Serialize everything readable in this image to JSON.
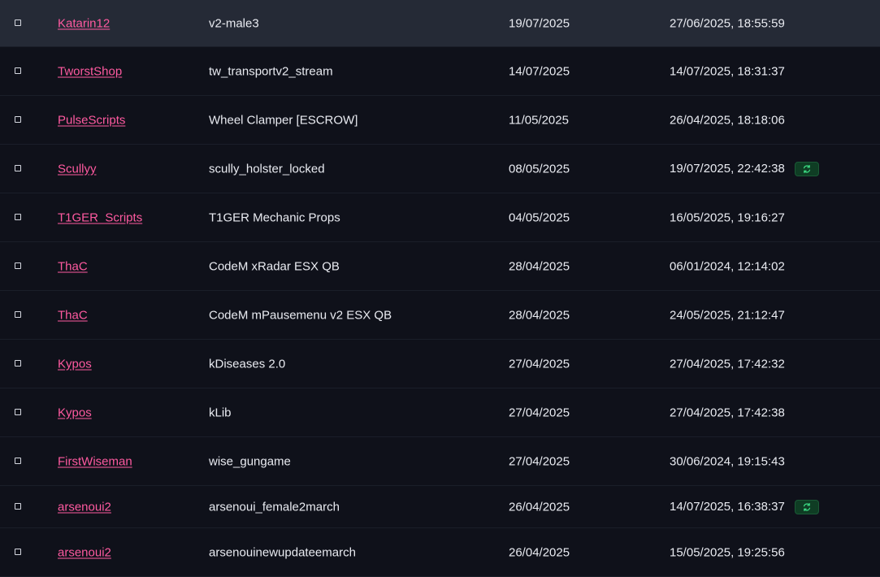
{
  "colors": {
    "background": "#0f111a",
    "row_highlight": "#252a36",
    "link": "#ff5aa0",
    "badge_bg": "#0f3d24",
    "badge_icon": "#3ddc84"
  },
  "rows": [
    {
      "seller": "Katarin12",
      "product": "v2-male3",
      "date": "19/07/2025",
      "updated": "27/06/2025, 18:55:59",
      "badge": false,
      "highlight": true
    },
    {
      "seller": "TworstShop",
      "product": "tw_transportv2_stream",
      "date": "14/07/2025",
      "updated": "14/07/2025, 18:31:37",
      "badge": false
    },
    {
      "seller": "PulseScripts",
      "product": "Wheel Clamper [ESCROW]",
      "date": "11/05/2025",
      "updated": "26/04/2025, 18:18:06",
      "badge": false
    },
    {
      "seller": "Scullyy",
      "product": "scully_holster_locked",
      "date": "08/05/2025",
      "updated": "19/07/2025, 22:42:38",
      "badge": true,
      "badge_icon": "refresh-icon"
    },
    {
      "seller": "T1GER_Scripts",
      "product": "T1GER Mechanic Props",
      "date": "04/05/2025",
      "updated": "16/05/2025, 19:16:27",
      "badge": false
    },
    {
      "seller": "ThaC",
      "product": "CodeM xRadar ESX QB",
      "date": "28/04/2025",
      "updated": "06/01/2024, 12:14:02",
      "badge": false
    },
    {
      "seller": "ThaC",
      "product": "CodeM mPausemenu v2 ESX QB",
      "date": "28/04/2025",
      "updated": "24/05/2025, 21:12:47",
      "badge": false
    },
    {
      "seller": "Kypos",
      "product": "kDiseases 2.0",
      "date": "27/04/2025",
      "updated": "27/04/2025, 17:42:32",
      "badge": false
    },
    {
      "seller": "Kypos",
      "product": "kLib",
      "date": "27/04/2025",
      "updated": "27/04/2025, 17:42:38",
      "badge": false
    },
    {
      "seller": "FirstWiseman",
      "product": "wise_gungame",
      "date": "27/04/2025",
      "updated": "30/06/2024, 19:15:43",
      "badge": false
    },
    {
      "seller": "arsenoui2",
      "product": "arsenoui_female2march",
      "date": "26/04/2025",
      "updated": "14/07/2025, 16:38:37",
      "badge": true,
      "badge_icon": "refresh-icon"
    },
    {
      "seller": "arsenoui2",
      "product": "arsenouinewupdateemarch",
      "date": "26/04/2025",
      "updated": "15/05/2025, 19:25:56",
      "badge": false
    }
  ]
}
